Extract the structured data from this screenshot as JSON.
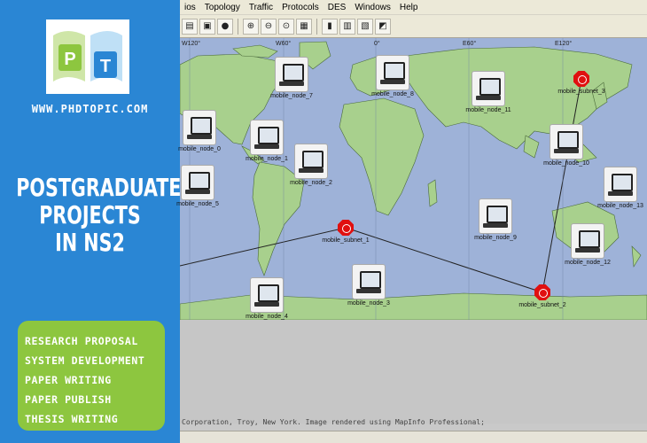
{
  "promo": {
    "logo_letters": [
      "P",
      "T"
    ],
    "site_url": "WWW.PHDTOPIC.COM",
    "headline": [
      "POSTGRADUATE",
      "PROJECTS",
      "IN NS2"
    ],
    "services": [
      "RESEARCH PROPOSAL",
      "SYSTEM DEVELOPMENT",
      "PAPER WRITING",
      "PAPER PUBLISH",
      "THESIS WRITING"
    ],
    "colors": {
      "panel": "#2a86d4",
      "services_box": "#8dc63f"
    }
  },
  "menubar": {
    "items": [
      "ios",
      "Topology",
      "Traffic",
      "Protocols",
      "DES",
      "Windows",
      "Help"
    ]
  },
  "map": {
    "longitude_ticks": [
      "W120°",
      "W60°",
      "0°",
      "E60°",
      "E120°"
    ],
    "nodes": [
      {
        "label": "mobile_node_7"
      },
      {
        "label": "mobile_node_8"
      },
      {
        "label": "mobile_node_11"
      },
      {
        "label": "mobile_node_0"
      },
      {
        "label": "mobile_node_1"
      },
      {
        "label": "mobile_node_2"
      },
      {
        "label": "mobile_node_10"
      },
      {
        "label": "mobile_node_5"
      },
      {
        "label": "mobile_node_13"
      },
      {
        "label": "mobile_node_9"
      },
      {
        "label": "mobile_node_12"
      },
      {
        "label": "mobile_node_3"
      },
      {
        "label": "mobile_node_4"
      }
    ],
    "subnets": [
      {
        "label": "mobile_subnet_3"
      },
      {
        "label": "mobile_subnet_1"
      },
      {
        "label": "mobile_subnet_2"
      }
    ],
    "colors": {
      "ocean": "#9eb2d8",
      "land": "#a8d08d",
      "subnet": "#e01010"
    }
  },
  "footer": {
    "copyright": "Corporation, Troy, New York. Image rendered using MapInfo Professional;"
  }
}
